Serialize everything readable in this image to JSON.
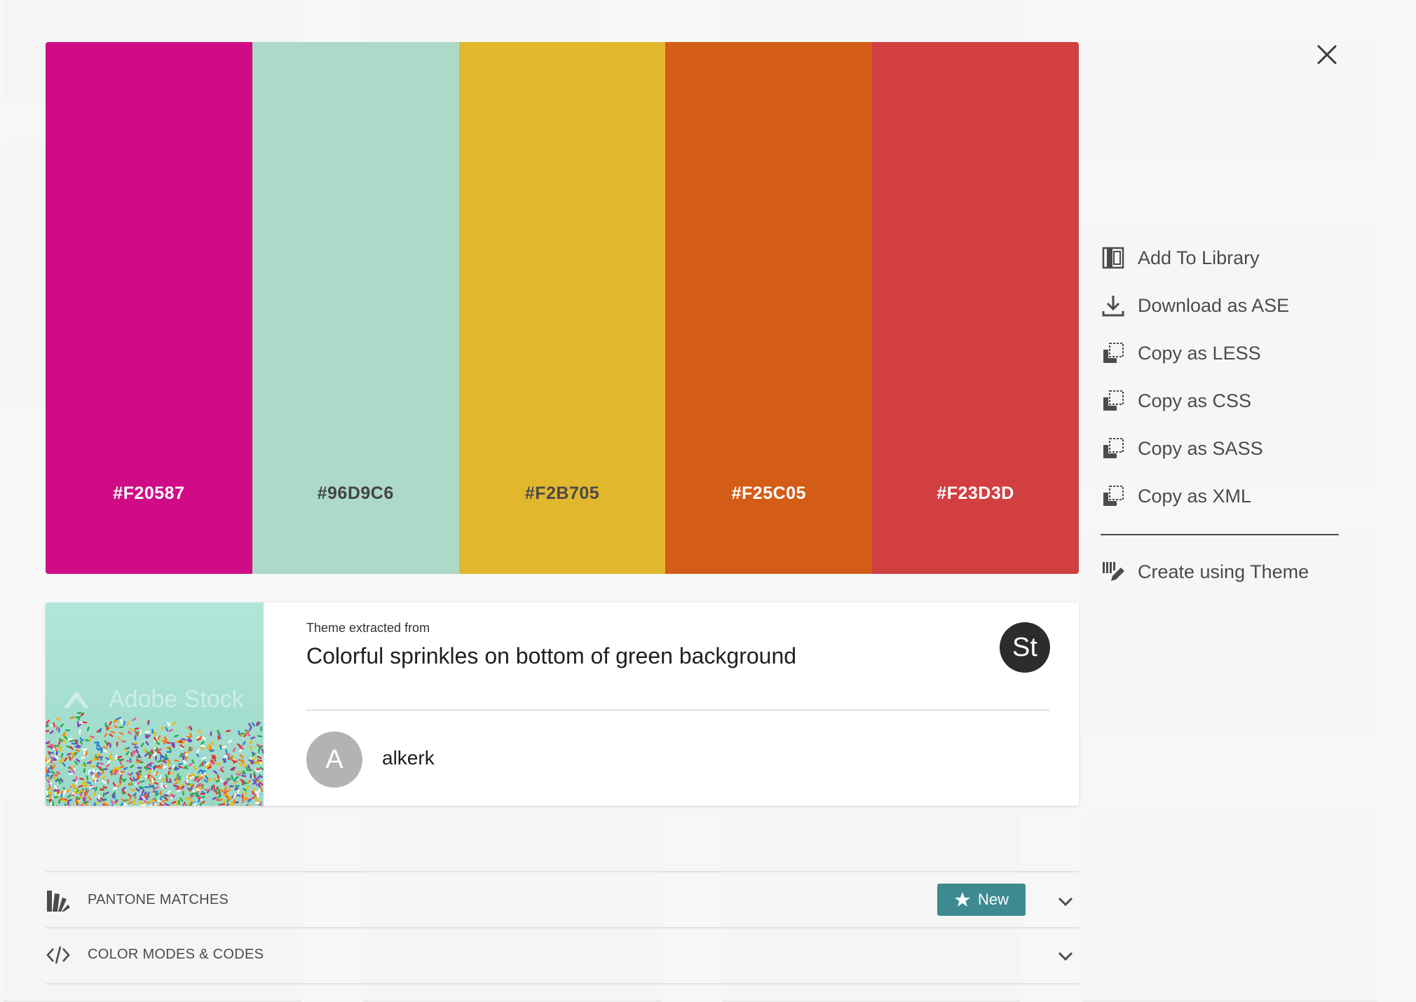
{
  "dialog": {
    "close_label": "Close"
  },
  "palette": {
    "swatches": [
      {
        "hex_label": "#F20587",
        "color": "#cf0c86",
        "text_color": "#ffffff"
      },
      {
        "hex_label": "#96D9C6",
        "color": "#acd9c8",
        "text_color": "#444444"
      },
      {
        "hex_label": "#F2B705",
        "color": "#e1b72d",
        "text_color": "#4a4a4a"
      },
      {
        "hex_label": "#F25C05",
        "color": "#d35d17",
        "text_color": "#ffffff"
      },
      {
        "hex_label": "#F23D3D",
        "color": "#d23f40",
        "text_color": "#ffffff"
      }
    ]
  },
  "actions": {
    "add_library": "Add To Library",
    "download_ase": "Download as ASE",
    "copy_less": "Copy as LESS",
    "copy_css": "Copy as CSS",
    "copy_sass": "Copy as SASS",
    "copy_xml": "Copy as XML",
    "create_theme": "Create using Theme"
  },
  "source_card": {
    "label": "Theme extracted from",
    "title": "Colorful sprinkles on bottom of green background",
    "stock_badge": "St",
    "watermark": "Adobe Stock",
    "user_initial": "A",
    "username": "alkerk"
  },
  "sections": {
    "pantone": {
      "label": "PANTONE MATCHES",
      "badge": "New"
    },
    "color_modes": {
      "label": "COLOR MODES & CODES"
    }
  },
  "colors": {
    "accent": "#3e8a91",
    "text_muted": "#4b4b4b"
  },
  "icons": {
    "close": "close-icon",
    "library": "library-icon",
    "download": "download-icon",
    "copy": "copy-icon",
    "create": "create-icon",
    "stock": "stock-icon",
    "pantone": "pantone-fan-icon",
    "code": "code-icon",
    "star": "star-icon",
    "chevron": "chevron-down-icon"
  }
}
